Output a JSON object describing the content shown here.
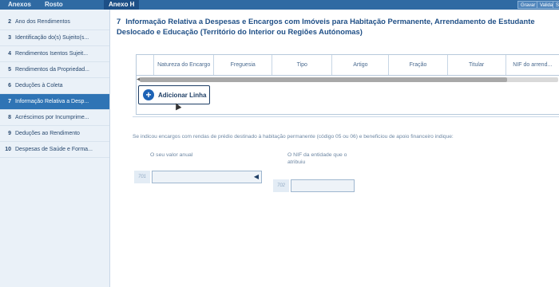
{
  "topbar": {
    "tabs": [
      "Anexos",
      "Rosto",
      "Anexo H"
    ],
    "buttons": [
      "Gravar",
      "Validar",
      "S"
    ]
  },
  "sidebar": {
    "items": [
      {
        "num": "2",
        "label": "Ano dos Rendimentos"
      },
      {
        "num": "3",
        "label": "Identificação do(s) Sujeito(s..."
      },
      {
        "num": "4",
        "label": "Rendimentos Isentos Sujeit..."
      },
      {
        "num": "5",
        "label": "Rendimentos da Propriedad..."
      },
      {
        "num": "6",
        "label": "Deduções à Coleta"
      },
      {
        "num": "7",
        "label": "Informação Relativa a Desp..."
      },
      {
        "num": "8",
        "label": "Acréscimos por Incumprime..."
      },
      {
        "num": "9",
        "label": "Deduções ao Rendimento"
      },
      {
        "num": "10",
        "label": "Despesas de Saúde e Forma..."
      }
    ]
  },
  "section": {
    "number": "7",
    "title": "Informação Relativa a Despesas e Encargos com Imóveis para Habitação Permanente, Arrendamento de Estudante Deslocado e Educação (Território do Interior ou Regiões Autónomas)"
  },
  "grid": {
    "columns": [
      "Natureza do Encargo",
      "Freguesia",
      "Tipo",
      "Artigo",
      "Fração",
      "Titular",
      "NIF do arrend..."
    ]
  },
  "add_line": {
    "label": "Adicionar Linha"
  },
  "hint": "Se indicou encargos com rendas de prédio destinado à habitação permanente (código 05 ou 06) e beneficiou de apoio financeiro indique:",
  "fields": {
    "annual_value": {
      "label": "O seu valor anual",
      "code": "701",
      "value": ""
    },
    "nif_entity": {
      "label": "O NIF da entidade que o atribuiu",
      "code": "702",
      "value": ""
    }
  }
}
